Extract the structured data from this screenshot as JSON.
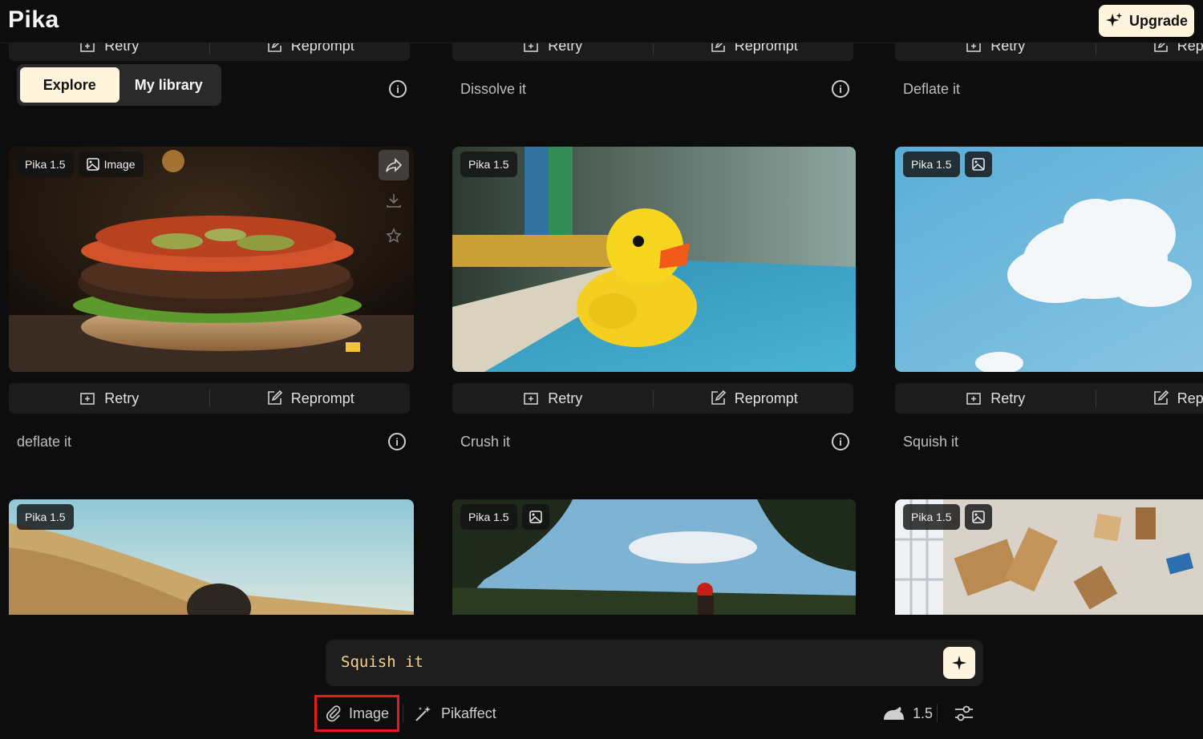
{
  "app": {
    "logo": "Pika",
    "upgrade_label": "Upgrade"
  },
  "tabs": [
    {
      "label": "Explore",
      "active": true
    },
    {
      "label": "My library",
      "active": false
    }
  ],
  "actions": {
    "retry": "Retry",
    "reprompt": "Reprompt"
  },
  "columns": [
    {
      "top_prompt": "",
      "cards": [
        {
          "model": "Pika 1.5",
          "type_label": "Image",
          "scene": "burger",
          "prompt": "deflate it"
        },
        {
          "model": "Pika 1.5",
          "type_label": "",
          "scene": "desert"
        }
      ]
    },
    {
      "top_prompt": "Dissolve it",
      "cards": [
        {
          "model": "Pika 1.5",
          "type_label": "",
          "scene": "duck",
          "prompt": "Crush it"
        },
        {
          "model": "Pika 1.5",
          "type_label": "image-icon",
          "scene": "trees"
        }
      ]
    },
    {
      "top_prompt": "Deflate it",
      "cards": [
        {
          "model": "Pika 1.5",
          "type_label": "image-icon",
          "scene": "cloud",
          "prompt": "Squish it"
        },
        {
          "model": "Pika 1.5",
          "type_label": "image-icon",
          "scene": "chairs"
        }
      ]
    }
  ],
  "composer": {
    "prompt_value": "Squish it",
    "image_label": "Image",
    "pikaffect_label": "Pikaffect",
    "model_version": "1.5"
  },
  "colors": {
    "accent": "#fff4dd",
    "highlight": "#e01e1e",
    "prompt_text": "#f5d28a"
  }
}
